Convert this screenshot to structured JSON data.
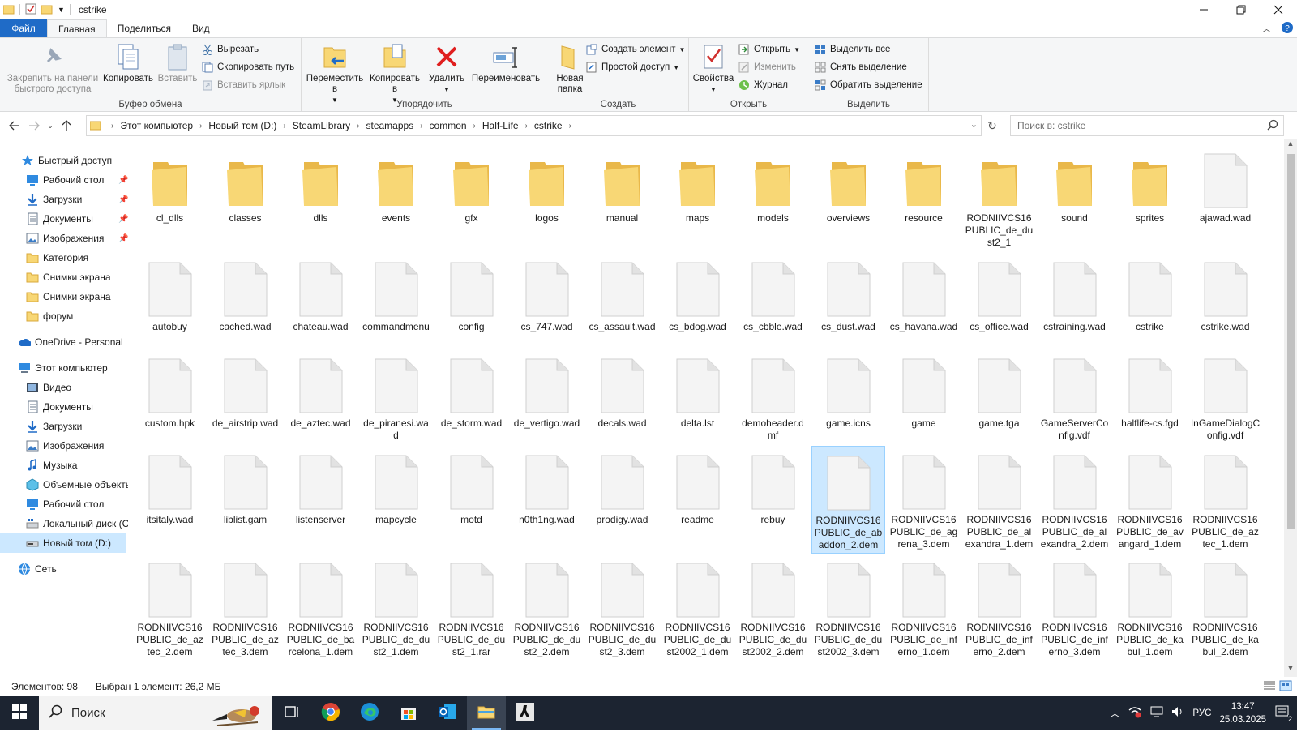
{
  "window": {
    "title": "cstrike"
  },
  "ribbon_tabs": {
    "file": "Файл",
    "home": "Главная",
    "share": "Поделиться",
    "view": "Вид"
  },
  "ribbon": {
    "clipboard": {
      "label": "Буфер обмена",
      "pin_line1": "Закрепить на панели",
      "pin_line2": "быстрого доступа",
      "copy": "Копировать",
      "paste": "Вставить",
      "cut": "Вырезать",
      "copy_path": "Скопировать путь",
      "paste_shortcut": "Вставить ярлык"
    },
    "organize": {
      "label": "Упорядочить",
      "move_line1": "Переместить",
      "move_line2": "в",
      "copyto_line1": "Копировать",
      "copyto_line2": "в",
      "delete": "Удалить",
      "rename": "Переименовать"
    },
    "new": {
      "label": "Создать",
      "folder_line1": "Новая",
      "folder_line2": "папка",
      "new_item": "Создать элемент",
      "easy_access": "Простой доступ"
    },
    "open": {
      "label": "Открыть",
      "properties": "Свойства",
      "open": "Открыть",
      "edit": "Изменить",
      "history": "Журнал"
    },
    "select": {
      "label": "Выделить",
      "select_all": "Выделить все",
      "select_none": "Снять выделение",
      "invert": "Обратить выделение"
    }
  },
  "address": {
    "crumbs": [
      "Этот компьютер",
      "Новый том (D:)",
      "SteamLibrary",
      "steamapps",
      "common",
      "Half-Life",
      "cstrike"
    ],
    "search_placeholder": "Поиск в: cstrike"
  },
  "nav": {
    "quick_access": "Быстрый доступ",
    "items": [
      {
        "label": "Рабочий стол",
        "icon": "desktop-icon",
        "pinned": true
      },
      {
        "label": "Загрузки",
        "icon": "downloads-icon",
        "pinned": true
      },
      {
        "label": "Документы",
        "icon": "documents-icon",
        "pinned": true
      },
      {
        "label": "Изображения",
        "icon": "pictures-icon",
        "pinned": true
      },
      {
        "label": "Категория",
        "icon": "folder-icon",
        "pinned": false
      },
      {
        "label": "Снимки экрана",
        "icon": "folder-icon",
        "pinned": false
      },
      {
        "label": "Снимки экрана",
        "icon": "folder-icon",
        "pinned": false
      },
      {
        "label": "форум",
        "icon": "folder-icon",
        "pinned": false
      }
    ],
    "onedrive": "OneDrive - Personal",
    "this_pc": "Этот компьютер",
    "pc_items": [
      {
        "label": "Видео",
        "icon": "videos-icon"
      },
      {
        "label": "Документы",
        "icon": "documents-icon"
      },
      {
        "label": "Загрузки",
        "icon": "downloads-icon"
      },
      {
        "label": "Изображения",
        "icon": "pictures-icon"
      },
      {
        "label": "Музыка",
        "icon": "music-icon"
      },
      {
        "label": "Объемные объекты",
        "icon": "3d-objects-icon"
      },
      {
        "label": "Рабочий стол",
        "icon": "desktop-icon"
      },
      {
        "label": "Локальный диск (C:)",
        "icon": "drive-c-icon"
      },
      {
        "label": "Новый том (D:)",
        "icon": "drive-d-icon",
        "selected": true
      }
    ],
    "network": "Сеть"
  },
  "files": [
    {
      "name": "cl_dlls",
      "type": "folder"
    },
    {
      "name": "classes",
      "type": "folder"
    },
    {
      "name": "dlls",
      "type": "folder"
    },
    {
      "name": "events",
      "type": "folder"
    },
    {
      "name": "gfx",
      "type": "folder"
    },
    {
      "name": "logos",
      "type": "folder"
    },
    {
      "name": "manual",
      "type": "folder"
    },
    {
      "name": "maps",
      "type": "folder"
    },
    {
      "name": "models",
      "type": "folder"
    },
    {
      "name": "overviews",
      "type": "folder"
    },
    {
      "name": "resource",
      "type": "folder"
    },
    {
      "name": "RODNIIVCS16PUBLIC_de_dust2_1",
      "type": "folder"
    },
    {
      "name": "sound",
      "type": "folder"
    },
    {
      "name": "sprites",
      "type": "folder"
    },
    {
      "name": "ajawad.wad",
      "type": "file"
    },
    {
      "name": "autobuy",
      "type": "file"
    },
    {
      "name": "cached.wad",
      "type": "file"
    },
    {
      "name": "chateau.wad",
      "type": "file"
    },
    {
      "name": "commandmenu",
      "type": "file"
    },
    {
      "name": "config",
      "type": "file"
    },
    {
      "name": "cs_747.wad",
      "type": "file"
    },
    {
      "name": "cs_assault.wad",
      "type": "file"
    },
    {
      "name": "cs_bdog.wad",
      "type": "file"
    },
    {
      "name": "cs_cbble.wad",
      "type": "file"
    },
    {
      "name": "cs_dust.wad",
      "type": "file"
    },
    {
      "name": "cs_havana.wad",
      "type": "file"
    },
    {
      "name": "cs_office.wad",
      "type": "file"
    },
    {
      "name": "cstraining.wad",
      "type": "file"
    },
    {
      "name": "cstrike",
      "type": "file"
    },
    {
      "name": "cstrike.wad",
      "type": "file"
    },
    {
      "name": "custom.hpk",
      "type": "file"
    },
    {
      "name": "de_airstrip.wad",
      "type": "file"
    },
    {
      "name": "de_aztec.wad",
      "type": "file"
    },
    {
      "name": "de_piranesi.wad",
      "type": "file"
    },
    {
      "name": "de_storm.wad",
      "type": "file"
    },
    {
      "name": "de_vertigo.wad",
      "type": "file"
    },
    {
      "name": "decals.wad",
      "type": "file"
    },
    {
      "name": "delta.lst",
      "type": "file"
    },
    {
      "name": "demoheader.dmf",
      "type": "file"
    },
    {
      "name": "game.icns",
      "type": "file"
    },
    {
      "name": "game",
      "type": "file"
    },
    {
      "name": "game.tga",
      "type": "file"
    },
    {
      "name": "GameServerConfig.vdf",
      "type": "file"
    },
    {
      "name": "halflife-cs.fgd",
      "type": "file"
    },
    {
      "name": "InGameDialogConfig.vdf",
      "type": "file"
    },
    {
      "name": "itsitaly.wad",
      "type": "file"
    },
    {
      "name": "liblist.gam",
      "type": "file"
    },
    {
      "name": "listenserver",
      "type": "file"
    },
    {
      "name": "mapcycle",
      "type": "file"
    },
    {
      "name": "motd",
      "type": "file"
    },
    {
      "name": "n0th1ng.wad",
      "type": "file"
    },
    {
      "name": "prodigy.wad",
      "type": "file"
    },
    {
      "name": "readme",
      "type": "file"
    },
    {
      "name": "rebuy",
      "type": "file"
    },
    {
      "name": "RODNIIVCS16PUBLIC_de_abaddon_2.dem",
      "type": "file",
      "selected": true
    },
    {
      "name": "RODNIIVCS16PUBLIC_de_agrena_3.dem",
      "type": "file"
    },
    {
      "name": "RODNIIVCS16PUBLIC_de_alexandra_1.dem",
      "type": "file"
    },
    {
      "name": "RODNIIVCS16PUBLIC_de_alexandra_2.dem",
      "type": "file"
    },
    {
      "name": "RODNIIVCS16PUBLIC_de_avangard_1.dem",
      "type": "file"
    },
    {
      "name": "RODNIIVCS16PUBLIC_de_aztec_1.dem",
      "type": "file"
    },
    {
      "name": "RODNIIVCS16PUBLIC_de_aztec_2.dem",
      "type": "file"
    },
    {
      "name": "RODNIIVCS16PUBLIC_de_aztec_3.dem",
      "type": "file"
    },
    {
      "name": "RODNIIVCS16PUBLIC_de_barcelona_1.dem",
      "type": "file"
    },
    {
      "name": "RODNIIVCS16PUBLIC_de_dust2_1.dem",
      "type": "file"
    },
    {
      "name": "RODNIIVCS16PUBLIC_de_dust2_1.rar",
      "type": "file"
    },
    {
      "name": "RODNIIVCS16PUBLIC_de_dust2_2.dem",
      "type": "file"
    },
    {
      "name": "RODNIIVCS16PUBLIC_de_dust2_3.dem",
      "type": "file"
    },
    {
      "name": "RODNIIVCS16PUBLIC_de_dust2002_1.dem",
      "type": "file"
    },
    {
      "name": "RODNIIVCS16PUBLIC_de_dust2002_2.dem",
      "type": "file"
    },
    {
      "name": "RODNIIVCS16PUBLIC_de_dust2002_3.dem",
      "type": "file"
    },
    {
      "name": "RODNIIVCS16PUBLIC_de_inferno_1.dem",
      "type": "file"
    },
    {
      "name": "RODNIIVCS16PUBLIC_de_inferno_2.dem",
      "type": "file"
    },
    {
      "name": "RODNIIVCS16PUBLIC_de_inferno_3.dem",
      "type": "file"
    },
    {
      "name": "RODNIIVCS16PUBLIC_de_kabul_1.dem",
      "type": "file"
    },
    {
      "name": "RODNIIVCS16PUBLIC_de_kabul_2.dem",
      "type": "file"
    }
  ],
  "status": {
    "count": "Элементов: 98",
    "selection": "Выбран 1 элемент: 26,2 МБ"
  },
  "taskbar": {
    "search_label": "Поиск",
    "apps": [
      "task-view-icon",
      "chrome-icon",
      "edge-icon",
      "store-icon",
      "outlook-icon",
      "file-explorer-icon",
      "counter-strike-icon"
    ],
    "language": "РУС",
    "time": "13:47",
    "date": "25.03.2025",
    "notifications": "2"
  },
  "colors": {
    "accent": "#1f6bc7",
    "selection": "#cce8ff",
    "folder": "#f8d775",
    "taskbar": "#1c2431"
  }
}
